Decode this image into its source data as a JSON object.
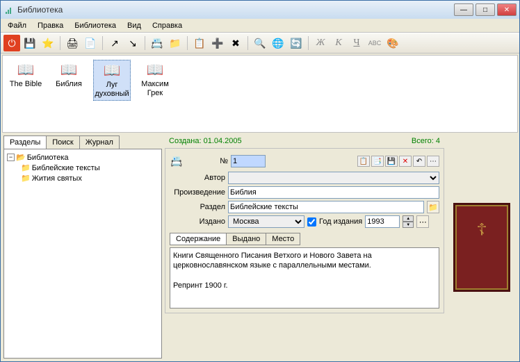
{
  "window": {
    "title": "Библиотека"
  },
  "menu": {
    "file": "Файл",
    "edit": "Правка",
    "library": "Библиотека",
    "view": "Вид",
    "help": "Справка"
  },
  "books": [
    {
      "label": "The Bible"
    },
    {
      "label": "Библия"
    },
    {
      "label": "Луг духовный"
    },
    {
      "label": "Максим Грек"
    }
  ],
  "left_tabs": {
    "sections": "Разделы",
    "search": "Поиск",
    "journal": "Журнал"
  },
  "tree": {
    "root": "Библиотека",
    "child1": "Библейские тексты",
    "child2": "Жития святых"
  },
  "status": {
    "created_label": "Создана:",
    "created_date": "01.04.2005",
    "total_label": "Всего:",
    "total_count": "4"
  },
  "form": {
    "num_label": "№",
    "num_value": "1",
    "author_label": "Автор",
    "author_value": "",
    "work_label": "Произведение",
    "work_value": "Библия",
    "section_label": "Раздел",
    "section_value": "Библейские тексты",
    "published_label": "Издано",
    "published_value": "Москва",
    "year_label": "Год издания",
    "year_value": "1993"
  },
  "subtabs": {
    "content": "Содержание",
    "issued": "Выдано",
    "place": "Место"
  },
  "description": "Книги Священного Писания Ветхого и Нового Завета на церковнославянском языке с параллельными местами.\n\nРепринт 1900 г."
}
